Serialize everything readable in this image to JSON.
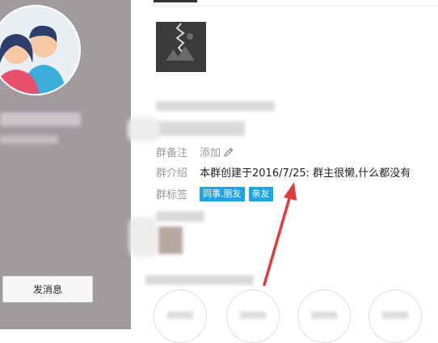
{
  "profile": {
    "send_message_label": "发消息"
  },
  "group_info": {
    "remark_label": "群备注",
    "remark_action": "添加",
    "intro_label": "群介绍",
    "intro_text": "本群创建于2016/7/25:  群主很懒,什么都没有",
    "tags_label": "群标签",
    "tags": [
      "同事,朋友",
      "亲友"
    ]
  },
  "colors": {
    "left_panel": "#a19a9f",
    "tag": "#1da4e6",
    "annotation_arrow": "#e33a3a"
  },
  "icons": {
    "remark_action_icon": "pencil-icon",
    "group_image_icon": "image-placeholder-icon"
  }
}
